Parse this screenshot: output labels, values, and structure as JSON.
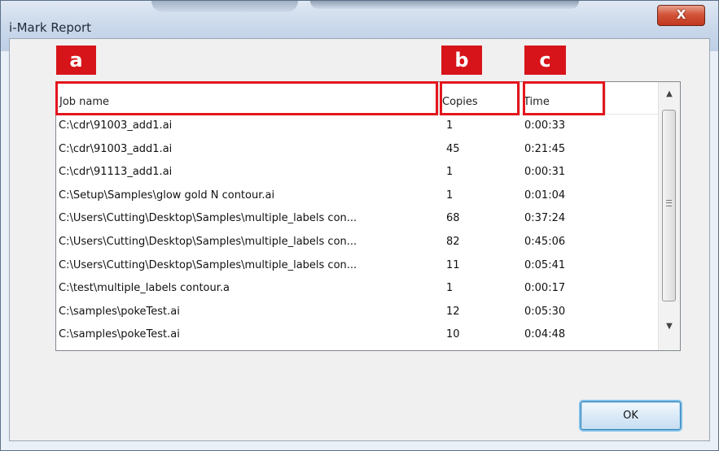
{
  "window": {
    "title": "i-Mark Report",
    "close_label": "X"
  },
  "markers": [
    "a",
    "b",
    "c"
  ],
  "columns": {
    "job": "Job name",
    "copies": "Copies",
    "time": "Time"
  },
  "rows": [
    {
      "job": "C:\\cdr\\91003_add1.ai",
      "copies": "1",
      "time": "0:00:33"
    },
    {
      "job": "C:\\cdr\\91003_add1.ai",
      "copies": "45",
      "time": "0:21:45"
    },
    {
      "job": "C:\\cdr\\91113_add1.ai",
      "copies": "1",
      "time": "0:00:31"
    },
    {
      "job": "C:\\Setup\\Samples\\glow gold N contour.ai",
      "copies": "1",
      "time": "0:01:04"
    },
    {
      "job": "C:\\Users\\Cutting\\Desktop\\Samples\\multiple_labels con...",
      "copies": "68",
      "time": "0:37:24"
    },
    {
      "job": "C:\\Users\\Cutting\\Desktop\\Samples\\multiple_labels con...",
      "copies": "82",
      "time": "0:45:06"
    },
    {
      "job": "C:\\Users\\Cutting\\Desktop\\Samples\\multiple_labels con...",
      "copies": "11",
      "time": "0:05:41"
    },
    {
      "job": "C:\\test\\multiple_labels contour.a",
      "copies": "1",
      "time": "0:00:17"
    },
    {
      "job": "C:\\samples\\pokeTest.ai",
      "copies": "12",
      "time": "0:05:30"
    },
    {
      "job": "C:\\samples\\pokeTest.ai",
      "copies": "10",
      "time": "0:04:48"
    }
  ],
  "scrollbar": {
    "up_icon": "arrow-up-icon",
    "down_icon": "arrow-down-icon"
  },
  "buttons": {
    "ok": "OK"
  },
  "colors": {
    "marker": "#d7141a",
    "highlight": "#e3161d",
    "close": "#c0381e"
  }
}
